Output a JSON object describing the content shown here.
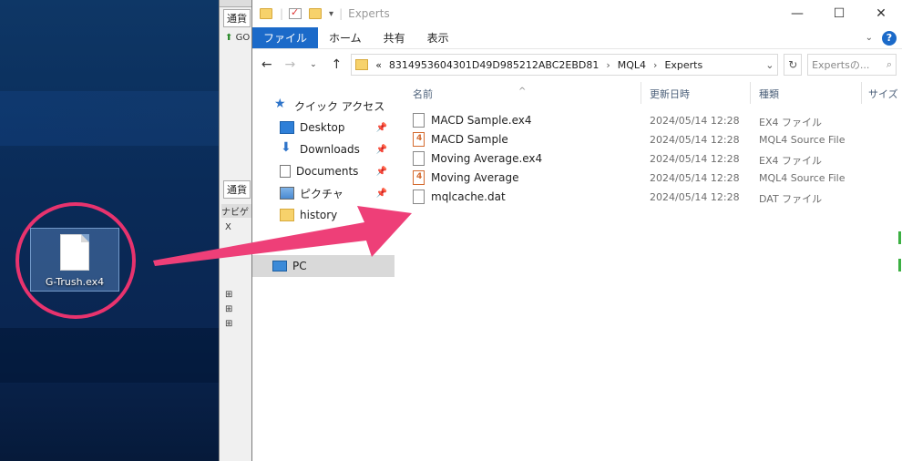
{
  "desktop": {
    "icon_label": "G-Trush.ex4"
  },
  "mt4": {
    "tab_top": "通貨",
    "tree_item": "GO",
    "tab_bottom": "通貨",
    "nav_header": "ナビゲ",
    "tree_x": "X"
  },
  "explorer": {
    "title": "Experts",
    "ribbon": {
      "tabs": [
        "ファイル",
        "ホーム",
        "共有",
        "表示"
      ]
    },
    "address": {
      "prefix": "«",
      "segments": [
        "8314953604301D49D985212ABC2EBD81",
        "MQL4",
        "Experts"
      ],
      "separator": "›"
    },
    "search": {
      "placeholder": "Expertsの..."
    },
    "nav_pane": {
      "quick_access": "クイック アクセス",
      "items": [
        {
          "label": "Desktop",
          "icon": "desktop-icon",
          "pinned": true
        },
        {
          "label": "Downloads",
          "icon": "download-icon",
          "pinned": true
        },
        {
          "label": "Documents",
          "icon": "document-icon",
          "pinned": true
        },
        {
          "label": "ピクチャ",
          "icon": "picture-icon",
          "pinned": true
        },
        {
          "label": "history",
          "icon": "folder-icon",
          "pinned": false
        }
      ],
      "pc": "PC"
    },
    "columns": [
      "名前",
      "更新日時",
      "種類",
      "サイズ"
    ],
    "files": [
      {
        "name": "MACD Sample.ex4",
        "date": "2024/05/14 12:28",
        "type": "EX4 ファイル",
        "icon": "file-icon"
      },
      {
        "name": "MACD Sample",
        "date": "2024/05/14 12:28",
        "type": "MQL4 Source File",
        "icon": "mql4-icon"
      },
      {
        "name": "Moving Average.ex4",
        "date": "2024/05/14 12:28",
        "type": "EX4 ファイル",
        "icon": "file-icon"
      },
      {
        "name": "Moving Average",
        "date": "2024/05/14 12:28",
        "type": "MQL4 Source File",
        "icon": "mql4-icon"
      },
      {
        "name": "mqlcache.dat",
        "date": "2024/05/14 12:28",
        "type": "DAT ファイル",
        "icon": "file-icon"
      }
    ]
  },
  "colors": {
    "annotation": "#e8336e",
    "ribbon_file": "#1b6ac9"
  }
}
